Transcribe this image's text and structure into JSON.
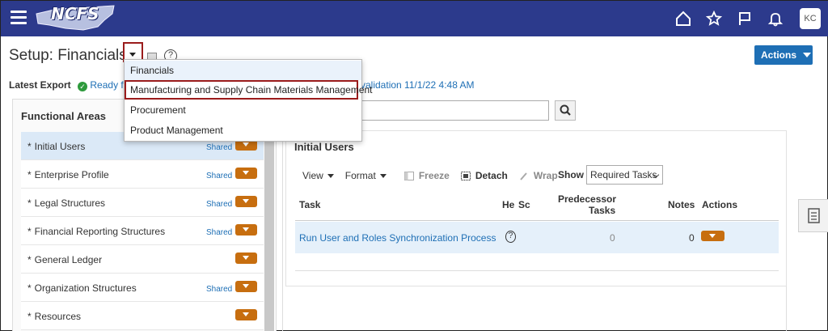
{
  "header": {
    "logo_text": "NCFS",
    "avatar_initials": "KC",
    "colors": {
      "bar": "#2c3a8c",
      "accent": "#1e6fb5",
      "menu_button": "#c76e0f",
      "highlight_border": "#9b1c1c"
    }
  },
  "page": {
    "title": "Setup: Financials",
    "actions_label": "Actions"
  },
  "export": {
    "label": "Latest Export",
    "status": "Ready for",
    "validation": "validation 11/1/22 4:48 AM"
  },
  "functional_areas": {
    "title": "Functional Areas",
    "items": [
      {
        "label": "Initial Users",
        "shared": "Shared",
        "selected": true
      },
      {
        "label": "Enterprise Profile",
        "shared": "Shared"
      },
      {
        "label": "Legal Structures",
        "shared": "Shared"
      },
      {
        "label": "Financial Reporting Structures",
        "shared": "Shared"
      },
      {
        "label": "General Ledger",
        "shared": ""
      },
      {
        "label": "Organization Structures",
        "shared": "Shared"
      },
      {
        "label": "Resources",
        "shared": ""
      }
    ]
  },
  "offering_dropdown": {
    "options": [
      "Financials",
      "Manufacturing and Supply Chain Materials Management",
      "Procurement",
      "Product Management"
    ],
    "highlighted_index": 1
  },
  "main": {
    "card_title": "Initial Users",
    "toolbar": {
      "view": "View",
      "format": "Format",
      "freeze": "Freeze",
      "detach": "Detach",
      "wrap": "Wrap",
      "show_label": "Show",
      "show_value": "Required Tasks"
    },
    "table": {
      "columns": {
        "task": "Task",
        "help": "He",
        "scope": "Sc",
        "predecessor_1": "Predecessor",
        "predecessor_2": "Tasks",
        "notes": "Notes",
        "actions": "Actions"
      },
      "rows": [
        {
          "task": "Run User and Roles Synchronization Process",
          "predecessor": "0",
          "notes": "0"
        }
      ]
    }
  }
}
